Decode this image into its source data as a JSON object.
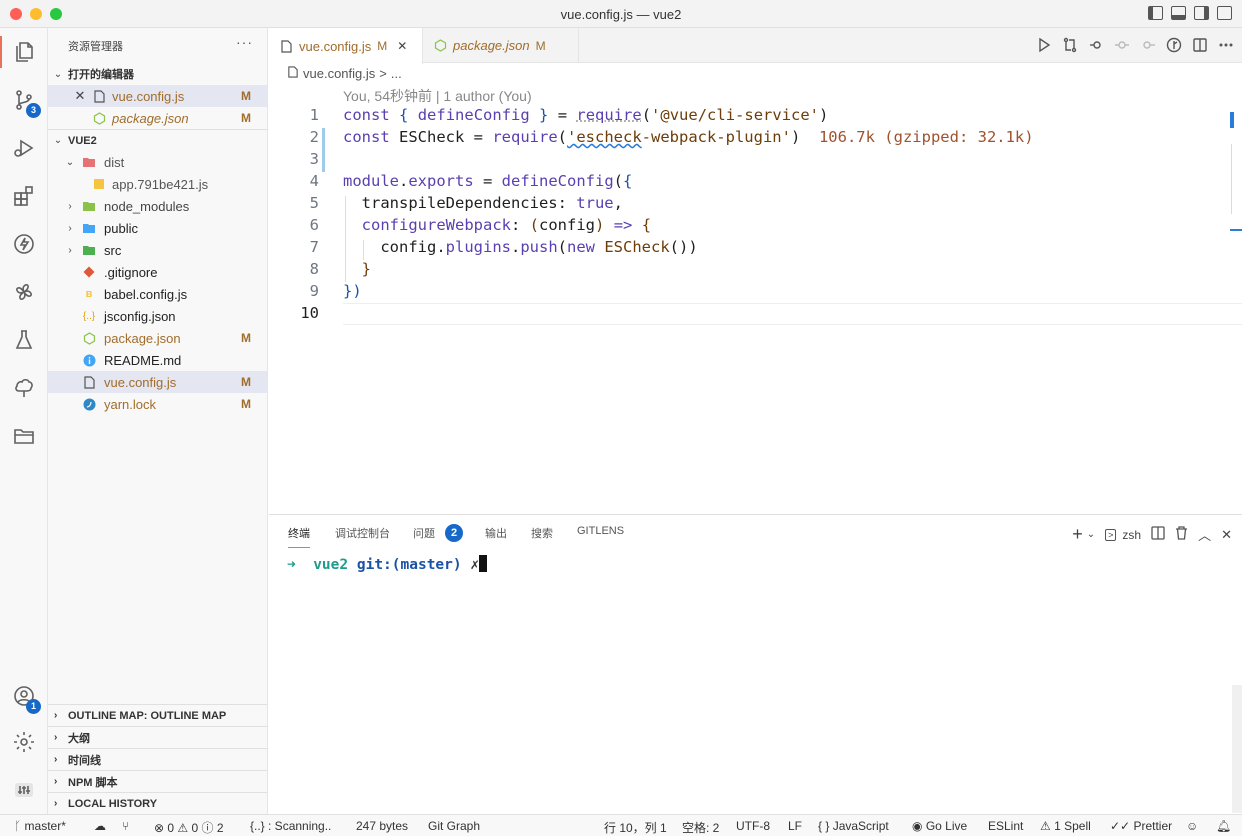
{
  "window": {
    "title": "vue.config.js — vue2"
  },
  "activity_bar": {
    "source_control_badge": "3",
    "accounts_badge": "1"
  },
  "sidebar": {
    "header": "资源管理器",
    "more": "···",
    "open_editors_title": "打开的编辑器",
    "open_editors": [
      {
        "name": "vue.config.js",
        "mark": "M"
      },
      {
        "name": "package.json",
        "mark": "M"
      }
    ],
    "project_title": "VUE2",
    "tree": [
      {
        "name": "dist",
        "mark": ""
      },
      {
        "name": "app.791be421.js",
        "mark": ""
      },
      {
        "name": "node_modules",
        "mark": ""
      },
      {
        "name": "public",
        "mark": ""
      },
      {
        "name": "src",
        "mark": ""
      },
      {
        "name": ".gitignore",
        "mark": ""
      },
      {
        "name": "babel.config.js",
        "mark": ""
      },
      {
        "name": "jsconfig.json",
        "mark": ""
      },
      {
        "name": "package.json",
        "mark": "M"
      },
      {
        "name": "README.md",
        "mark": ""
      },
      {
        "name": "vue.config.js",
        "mark": "M"
      },
      {
        "name": "yarn.lock",
        "mark": "M"
      }
    ],
    "bottom_sections": [
      "OUTLINE MAP: OUTLINE MAP",
      "大纲",
      "时间线",
      "NPM 脚本",
      "LOCAL HISTORY"
    ]
  },
  "tabs": [
    {
      "label": "vue.config.js",
      "mark": "M"
    },
    {
      "label": "package.json",
      "mark": "M"
    }
  ],
  "breadcrumb": {
    "file": "vue.config.js",
    "sep": ">",
    "rest": "..."
  },
  "editor": {
    "blame": "You, 54秒钟前 | 1 author (You)",
    "line_numbers": [
      "1",
      "2",
      "3",
      "4",
      "5",
      "6",
      "7",
      "8",
      "9",
      "10"
    ],
    "import_cost": "106.7k (gzipped: 32.1k)"
  },
  "panel": {
    "tabs": [
      "终端",
      "调试控制台",
      "问题",
      "输出",
      "搜索",
      "GITLENS"
    ],
    "problems_badge": "2",
    "shell": "zsh",
    "prompt_arrow": "➜",
    "prompt_dir": "vue2",
    "prompt_git": "git:(master)",
    "prompt_dirty": "✗"
  },
  "statusbar": {
    "branch": "master*",
    "errors": "0",
    "warnings": "0",
    "infos": "2",
    "scanning": "{..} : Scanning..",
    "size": "247 bytes",
    "git_graph": "Git Graph",
    "position": "行 10，列 1",
    "spaces": "空格: 2",
    "encoding": "UTF-8",
    "eol": "LF",
    "language": "JavaScript",
    "go_live": "Go Live",
    "eslint": "ESLint",
    "spell": "1 Spell",
    "prettier": "Prettier"
  },
  "colors": {
    "accent": "#e8715a",
    "badge": "#1669c8",
    "modified": "#a06d2c"
  }
}
